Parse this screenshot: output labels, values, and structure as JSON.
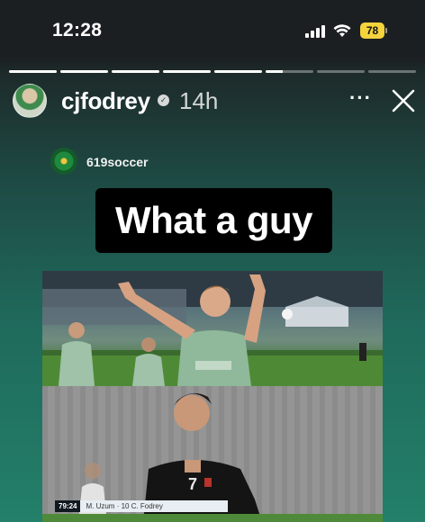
{
  "status_bar": {
    "time": "12:28",
    "battery": "78",
    "icons": [
      "signal-icon",
      "wifi-icon",
      "battery-icon"
    ]
  },
  "story": {
    "progress_segments": [
      1,
      1,
      1,
      1,
      1,
      0.35,
      0,
      0
    ],
    "username": "cjfodrey",
    "time_ago": "14h",
    "verified": true
  },
  "post": {
    "username": "619soccer",
    "caption": "What a guy",
    "scorebar": {
      "time": "79:24",
      "players": "M. Uzum · 10 C. Fodrey"
    }
  },
  "colors": {
    "accent": "#f5d33c",
    "background_top": "#1c1f22",
    "background_bottom": "#23806a"
  }
}
